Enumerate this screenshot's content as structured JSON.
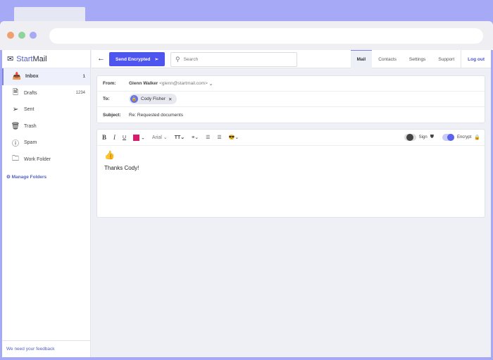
{
  "app": {
    "brand_a": "Start",
    "brand_b": "Mail"
  },
  "sidebar": {
    "items": [
      {
        "label": "Inbox",
        "count": "1",
        "icon": "inbox-icon",
        "glyph": "📥"
      },
      {
        "label": "Drafts",
        "count": "1234",
        "icon": "drafts-icon",
        "glyph": "🗎"
      },
      {
        "label": "Sent",
        "count": "",
        "icon": "send-icon",
        "glyph": "➢"
      },
      {
        "label": "Trash",
        "count": "",
        "icon": "trash-icon",
        "glyph": "🗑"
      },
      {
        "label": "Spam",
        "count": "",
        "icon": "spam-icon",
        "glyph": "ⓘ"
      },
      {
        "label": "Work Folder",
        "count": "",
        "icon": "folder-icon",
        "glyph": "🗀"
      }
    ],
    "manage": "Manage Folders",
    "feedback": "We need your feedback"
  },
  "toolbar": {
    "send": "Send Encrypted",
    "search_placeholder": "Search"
  },
  "menu": {
    "mail": "Mail",
    "contacts": "Contacts",
    "settings": "Settings",
    "support": "Support",
    "logout": "Log out"
  },
  "compose": {
    "from_label": "From:",
    "from_name": "Glenn Walker",
    "from_email": "<glenn@startmail.com>",
    "to_label": "To:",
    "to_chip": "Cody Fisher",
    "subject_label": "Subject:",
    "subject": "Re: Requested documents",
    "body_emoji": "👍",
    "body": "Thanks Cody!"
  },
  "editor": {
    "font": "Arial",
    "size": "TT",
    "sign": "Sign",
    "encrypt": "Encrypt",
    "text_color": "#d81b6a",
    "sign_on": false,
    "encrypt_on": true
  },
  "colors": {
    "accent": "#4e55ee"
  }
}
